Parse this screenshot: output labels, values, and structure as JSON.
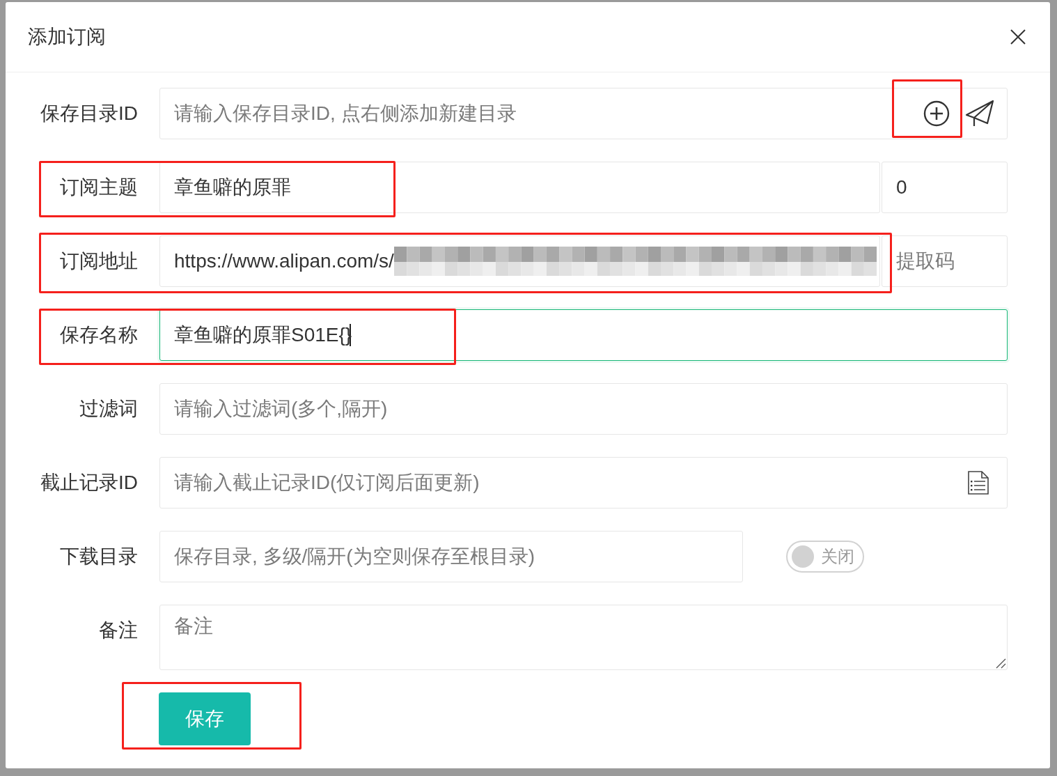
{
  "dialog": {
    "title": "添加订阅"
  },
  "fields": [
    {
      "kind": "input-actions",
      "label": "保存目录ID",
      "placeholder": "请输入保存目录ID, 点右侧添加新建目录",
      "focused": false,
      "highlighted": false,
      "actions": [
        {
          "kind": "add",
          "highlighted": true
        },
        {
          "kind": "send",
          "highlighted": false
        }
      ]
    },
    {
      "kind": "input-pair",
      "label": "订阅主题",
      "value": "章鱼噼的原罪",
      "focused": false,
      "highlighted": true,
      "side": {
        "value": "0"
      }
    },
    {
      "kind": "input-pair",
      "label": "订阅地址",
      "value": "https://www.alipan.com/s/",
      "redacted": true,
      "focused": false,
      "highlighted": true,
      "side": {
        "placeholder": "提取码"
      }
    },
    {
      "kind": "input",
      "label": "保存名称",
      "value": "章鱼噼的原罪S01E{}",
      "focused": true,
      "highlighted": true
    },
    {
      "kind": "input",
      "label": "过滤词",
      "placeholder": "请输入过滤词(多个,隔开)",
      "focused": false,
      "highlighted": false
    },
    {
      "kind": "input-actions",
      "label": "截止记录ID",
      "placeholder": "请输入截止记录ID(仅订阅后面更新)",
      "focused": false,
      "highlighted": false,
      "actions": [
        {
          "kind": "list",
          "highlighted": false
        }
      ]
    },
    {
      "kind": "input-switch",
      "label": "下载目录",
      "placeholder": "保存目录, 多级/隔开(为空则保存至根目录)",
      "focused": false,
      "highlighted": false,
      "switch": {
        "on": false,
        "label": "关闭"
      }
    },
    {
      "kind": "textarea",
      "label": "备注",
      "placeholder": "备注",
      "focused": false,
      "highlighted": false
    }
  ],
  "save_button": {
    "label": "保存",
    "highlighted": true
  }
}
